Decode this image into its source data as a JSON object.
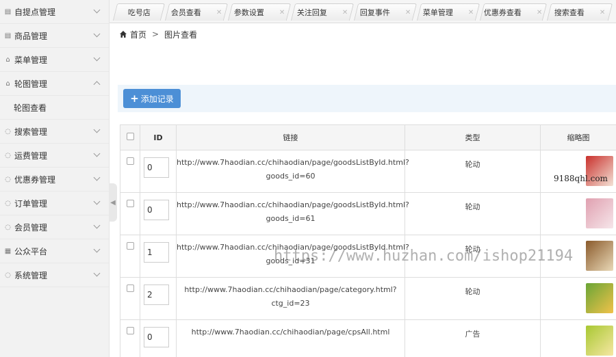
{
  "sidebar": {
    "items": [
      {
        "label": "自提点管理",
        "icon": "store-icon"
      },
      {
        "label": "商品管理",
        "icon": "product-icon"
      },
      {
        "label": "菜单管理",
        "icon": "bag-icon"
      },
      {
        "label": "轮图管理",
        "icon": "bag-icon",
        "expanded": true
      },
      {
        "label": "搜索管理",
        "icon": "chat-icon"
      },
      {
        "label": "运费管理",
        "icon": "chat-icon"
      },
      {
        "label": "优惠券管理",
        "icon": "chat-icon"
      },
      {
        "label": "订单管理",
        "icon": "chat-icon"
      },
      {
        "label": "会员管理",
        "icon": "chat-icon"
      },
      {
        "label": "公众平台",
        "icon": "grid-icon"
      },
      {
        "label": "系统管理",
        "icon": "chat-icon"
      }
    ],
    "submenu_label": "轮图查看"
  },
  "tabs": [
    {
      "label": "吃号店",
      "closable": false
    },
    {
      "label": "会员查看",
      "closable": true
    },
    {
      "label": "参数设置",
      "closable": true
    },
    {
      "label": "关注回复",
      "closable": true
    },
    {
      "label": "回复事件",
      "closable": true
    },
    {
      "label": "菜单管理",
      "closable": true
    },
    {
      "label": "优惠券查看",
      "closable": true
    },
    {
      "label": "搜索查看",
      "closable": true
    }
  ],
  "breadcrumb": {
    "home": "首页",
    "separator": ">",
    "current": "图片查看"
  },
  "toolbar": {
    "add_label": "添加记录"
  },
  "table": {
    "headers": {
      "id": "ID",
      "link": "链接",
      "type": "类型",
      "thumb": "缩略图"
    },
    "rows": [
      {
        "order": "0",
        "link_line1": "http://www.7haodian.cc/chihaodian/page/goodsListById.html?",
        "link_line2": "goods_id=60",
        "type": "轮动",
        "thumb_colors": [
          "#c9302c",
          "#f3e2d6"
        ]
      },
      {
        "order": "0",
        "link_line1": "http://www.7haodian.cc/chihaodian/page/goodsListById.html?",
        "link_line2": "goods_id=61",
        "type": "轮动",
        "thumb_colors": [
          "#e0a0b0",
          "#f6e6ea"
        ]
      },
      {
        "order": "1",
        "link_line1": "http://www.7haodian.cc/chihaodian/page/goodsListById.html?",
        "link_line2": "goods_id=31",
        "type": "轮动",
        "thumb_colors": [
          "#8a5a2b",
          "#e9d9b8"
        ]
      },
      {
        "order": "2",
        "link_line1": "http://www.7haodian.cc/chihaodian/page/category.html?",
        "link_line2": "ctg_id=23",
        "type": "轮动",
        "thumb_colors": [
          "#6aa536",
          "#f1c24a"
        ]
      },
      {
        "order": "0",
        "link_line1": "http://www.7haodian.cc/chihaodian/page/cpsAll.html",
        "link_line2": "",
        "type": "广告",
        "thumb_colors": [
          "#a8c832",
          "#f6e7a3"
        ]
      }
    ]
  },
  "watermarks": {
    "corner": "9188qhl.com",
    "overlay": "https://www.huzhan.com/ishop21194"
  }
}
